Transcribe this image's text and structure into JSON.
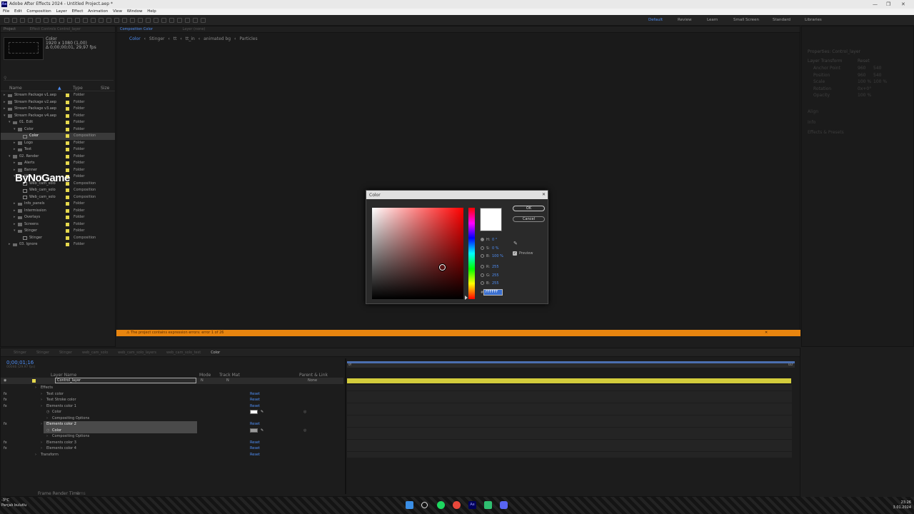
{
  "window": {
    "title": "Adobe After Effects 2024 - Untitled Project.aep *",
    "logo": "Ae",
    "controls": [
      "—",
      "❐",
      "✕"
    ]
  },
  "menu": [
    "File",
    "Edit",
    "Composition",
    "Layer",
    "Effect",
    "Animation",
    "View",
    "Window",
    "Help"
  ],
  "workspaces": [
    {
      "label": "Default",
      "active": true
    },
    {
      "label": "Review"
    },
    {
      "label": "Learn"
    },
    {
      "label": "Small Screen"
    },
    {
      "label": "Standard"
    },
    {
      "label": "Libraries"
    }
  ],
  "project_panel": {
    "tab": "Project",
    "effect_controls_tab": "Effect Controls Control_layer",
    "preview": {
      "name": "Color",
      "info": "1920 x 1080 (1,00)",
      "duration": "Δ 0;00;00;01, 29,97 fps"
    },
    "columns": {
      "name": "Name",
      "type": "Type",
      "size": "Size"
    },
    "items": [
      {
        "indent": 0,
        "kind": "folder",
        "name": "Stream Package v1.aep",
        "type": "Folder",
        "open": false
      },
      {
        "indent": 0,
        "kind": "folder",
        "name": "Stream Package v2.aep",
        "type": "Folder",
        "open": false
      },
      {
        "indent": 0,
        "kind": "folder",
        "name": "Stream Package v3.aep",
        "type": "Folder",
        "open": false
      },
      {
        "indent": 0,
        "kind": "folder",
        "name": "Stream Package v4.aep",
        "type": "Folder",
        "open": true
      },
      {
        "indent": 1,
        "kind": "folder",
        "name": "01. Edit",
        "type": "Folder",
        "open": true
      },
      {
        "indent": 2,
        "kind": "folder",
        "name": "Color",
        "type": "Folder",
        "open": true
      },
      {
        "indent": 3,
        "kind": "comp",
        "name": "Color",
        "type": "Composition",
        "selected": true
      },
      {
        "indent": 2,
        "kind": "folder",
        "name": "Logo",
        "type": "Folder",
        "open": false
      },
      {
        "indent": 2,
        "kind": "folder",
        "name": "Text",
        "type": "Folder",
        "open": false
      },
      {
        "indent": 1,
        "kind": "folder",
        "name": "02. Render",
        "type": "Folder",
        "open": true
      },
      {
        "indent": 2,
        "kind": "folder",
        "name": "Alerts",
        "type": "Folder",
        "open": false
      },
      {
        "indent": 2,
        "kind": "folder",
        "name": "Banner",
        "type": "Folder",
        "open": false
      },
      {
        "indent": 2,
        "kind": "folder",
        "name": "Web_cam",
        "type": "Folder",
        "open": true
      },
      {
        "indent": 3,
        "kind": "comp",
        "name": "Web_cam_solo",
        "type": "Composition"
      },
      {
        "indent": 3,
        "kind": "comp",
        "name": "Web_cam_solo",
        "type": "Composition"
      },
      {
        "indent": 3,
        "kind": "comp",
        "name": "Web_cam_solo",
        "type": "Composition"
      },
      {
        "indent": 2,
        "kind": "folder",
        "name": "Info_panels",
        "type": "Folder",
        "open": false
      },
      {
        "indent": 2,
        "kind": "folder",
        "name": "Intermission",
        "type": "Folder",
        "open": false
      },
      {
        "indent": 2,
        "kind": "folder",
        "name": "Overlays",
        "type": "Folder",
        "open": false
      },
      {
        "indent": 2,
        "kind": "folder",
        "name": "Screens",
        "type": "Folder",
        "open": false
      },
      {
        "indent": 2,
        "kind": "folder",
        "name": "Stinger",
        "type": "Folder",
        "open": true
      },
      {
        "indent": 3,
        "kind": "comp",
        "name": "Stinger",
        "type": "Composition"
      },
      {
        "indent": 1,
        "kind": "folder",
        "name": "03. Ignore",
        "type": "Folder",
        "open": false
      }
    ],
    "watermark": "ByNoGame"
  },
  "comp_viewer": {
    "tab": "Composition Color",
    "layer_tab": "Layer (none)",
    "breadcrumbs": [
      "Color",
      "Stinger",
      "tt",
      "tt_in",
      "animated bg",
      "Particles"
    ],
    "warning": "The project contains expression errors: error 1 of 26"
  },
  "color_dialog": {
    "title": "Color",
    "ok": "OK",
    "cancel": "Cancel",
    "hue_color": "#ff0000",
    "preview_color": "#ffffff",
    "hsb": [
      {
        "label": "H:",
        "value": "0 °"
      },
      {
        "label": "S:",
        "value": "0 %"
      },
      {
        "label": "B:",
        "value": "100 %"
      }
    ],
    "rgb": [
      {
        "label": "R:",
        "value": "255"
      },
      {
        "label": "G:",
        "value": "255"
      },
      {
        "label": "B:",
        "value": "255"
      }
    ],
    "hex": "FFFFFF",
    "preview_label": "Preview",
    "preview_checked": true
  },
  "timeline": {
    "tabs": [
      "Stinger",
      "Stinger",
      "Stinger",
      "web_cam_solo",
      "web_cam_solo_layers",
      "web_cam_solo_test",
      "Color"
    ],
    "timecode": "0;00;01;16",
    "fps": "00046 (29.97 fps)",
    "columns": {
      "layer_name": "Layer Name",
      "mode": "Mode",
      "trkmat": "Track Mat",
      "parent": "Parent & Link"
    },
    "layer": {
      "name": "Control_layer",
      "mode": "N",
      "trkmat": "N",
      "parent": "None"
    },
    "rows": [
      {
        "indent": 1,
        "label": "Effects",
        "fx": false,
        "reset": false
      },
      {
        "indent": 2,
        "label": "Text color",
        "fx": true,
        "reset": true
      },
      {
        "indent": 2,
        "label": "Text Stroke color",
        "fx": true,
        "reset": true
      },
      {
        "indent": 2,
        "label": "Elements color 1",
        "fx": true,
        "reset": true
      },
      {
        "indent": 3,
        "label": "Color",
        "fx": false,
        "reset": false,
        "swatch": "#ffffff"
      },
      {
        "indent": 3,
        "label": "Compositing Options",
        "fx": false,
        "reset": false
      },
      {
        "indent": 2,
        "label": "Elements color 2",
        "fx": true,
        "reset": true,
        "selected": true
      },
      {
        "indent": 3,
        "label": "Color",
        "fx": false,
        "reset": false,
        "swatch": "#9a9a9a",
        "selected": true
      },
      {
        "indent": 3,
        "label": "Compositing Options",
        "fx": false,
        "reset": false
      },
      {
        "indent": 2,
        "label": "Elements color 3",
        "fx": true,
        "reset": true
      },
      {
        "indent": 2,
        "label": "Elements color 4",
        "fx": true,
        "reset": true
      },
      {
        "indent": 1,
        "label": "Transform",
        "fx": false,
        "reset": true
      }
    ],
    "reset_label": "Reset",
    "footer": "Frame Render Time",
    "footer_value": "0ms",
    "ruler_start": "0f",
    "ruler_end": "01f"
  },
  "properties_panel": {
    "title": "Properties: Control_layer",
    "section": "Layer Transform",
    "reset": "Reset",
    "props": [
      {
        "label": "Anchor Point",
        "v1": "960",
        "v2": "540"
      },
      {
        "label": "Position",
        "v1": "960",
        "v2": "540"
      },
      {
        "label": "Scale",
        "v1": "100 %",
        "v2": "100 %"
      },
      {
        "label": "Rotation",
        "v1": "0x+0°",
        "v2": ""
      },
      {
        "label": "Opacity",
        "v1": "100 %",
        "v2": ""
      }
    ],
    "sections": [
      "Align",
      "Info",
      "Effects & Presets"
    ]
  },
  "taskbar": {
    "weather_temp": "-3°C",
    "weather_desc": "Parçalı bulutlu",
    "time": "23:26",
    "date": "3.01.2024"
  }
}
